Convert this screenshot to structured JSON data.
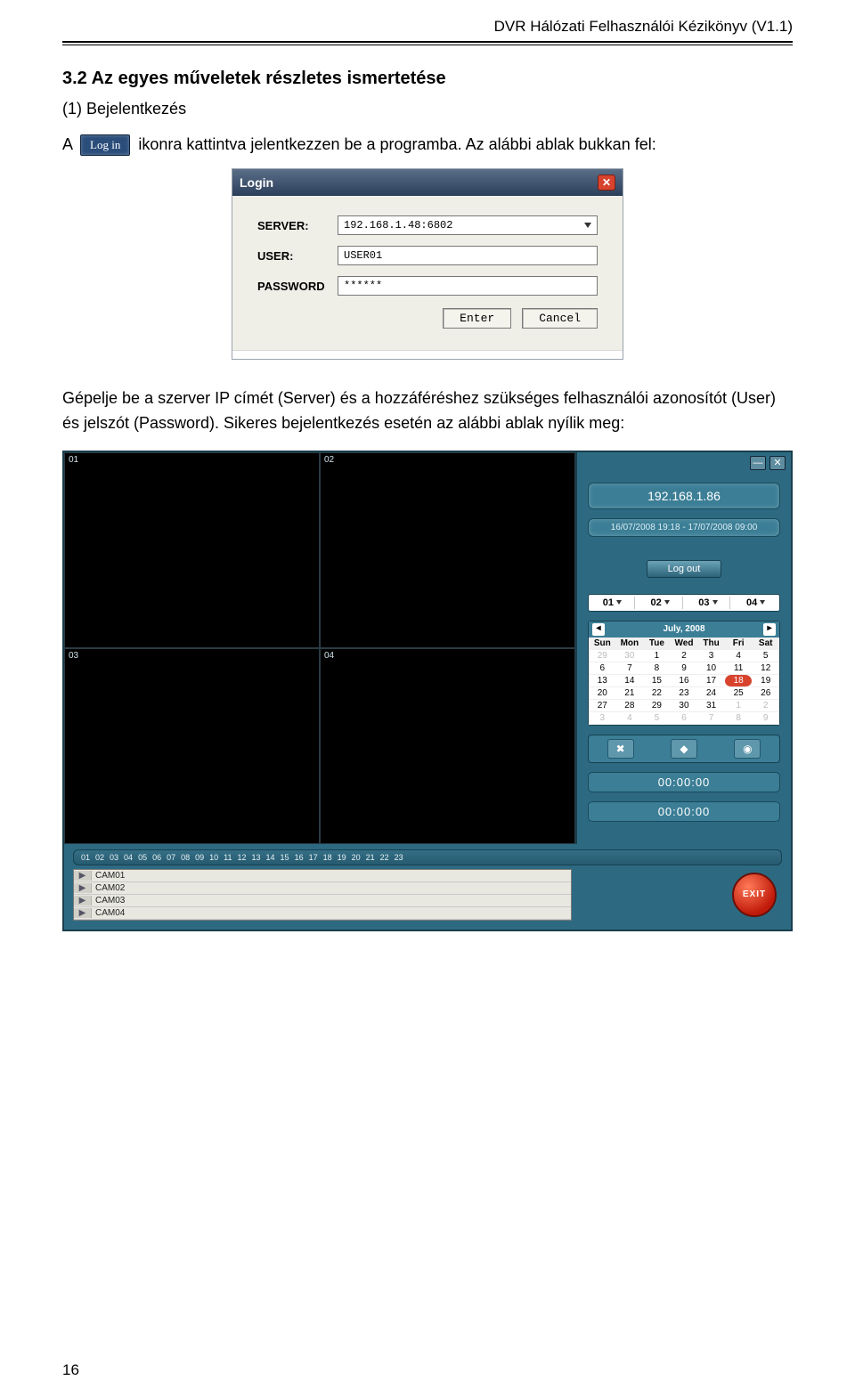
{
  "header": {
    "title": "DVR Hálózati Felhasználói Kézikönyv (V1.1)"
  },
  "page_number": "16",
  "section": {
    "title": "3.2 Az egyes műveletek részletes ismertetése",
    "step_label": "(1) Bejelentkezés",
    "lead_prefix": "A",
    "login_chip": "Log in",
    "lead_suffix": " ikonra kattintva jelentkezzen be a programba. Az alábbi ablak bukkan fel:"
  },
  "login_dialog": {
    "title": "Login",
    "close": "✕",
    "fields": {
      "server_label": "SERVER:",
      "server_value": "192.168.1.48:6802",
      "user_label": "USER:",
      "user_value": "USER01",
      "password_label": "PASSWORD",
      "password_value": "******"
    },
    "buttons": {
      "enter": "Enter",
      "cancel": "Cancel"
    }
  },
  "paragraph2": "Gépelje be a szerver IP címét (Server) és a hozzáféréshez szükséges felhasználói azonosítót (User) és jelszót (Password). Sikeres bejelentkezés esetén az alábbi ablak nyílik meg:",
  "dvr": {
    "cells": {
      "c1": "01",
      "c2": "02",
      "c3": "03",
      "c4": "04"
    },
    "winctrls": {
      "min": "—",
      "close": "✕"
    },
    "ip": "192.168.1.86",
    "date_range": "16/07/2008 19:18 - 17/07/2008 09:00",
    "logout": "Log out",
    "channels": [
      "01",
      "02",
      "03",
      "04"
    ],
    "calendar": {
      "title": "July, 2008",
      "prev": "◂",
      "next": "▸",
      "dow": [
        "Sun",
        "Mon",
        "Tue",
        "Wed",
        "Thu",
        "Fri",
        "Sat"
      ],
      "rows": [
        [
          "29",
          "30",
          "1",
          "2",
          "3",
          "4",
          "5"
        ],
        [
          "6",
          "7",
          "8",
          "9",
          "10",
          "11",
          "12"
        ],
        [
          "13",
          "14",
          "15",
          "16",
          "17",
          "18",
          "19"
        ],
        [
          "20",
          "21",
          "22",
          "23",
          "24",
          "25",
          "26"
        ],
        [
          "27",
          "28",
          "29",
          "30",
          "31",
          "1",
          "2"
        ],
        [
          "3",
          "4",
          "5",
          "6",
          "7",
          "8",
          "9"
        ]
      ],
      "out_first": 2,
      "out_last_start_row": 4,
      "out_last_start_col": 5,
      "selected": "18"
    },
    "icons": {
      "del": "✖",
      "play": "◆",
      "snap": "◉"
    },
    "timer1": "00:00:00",
    "timer2": "00:00:00",
    "timeline": [
      "01",
      "02",
      "03",
      "04",
      "05",
      "06",
      "07",
      "08",
      "09",
      "10",
      "11",
      "12",
      "13",
      "14",
      "15",
      "16",
      "17",
      "18",
      "19",
      "20",
      "21",
      "22",
      "23"
    ],
    "cams": [
      "CAM01",
      "CAM02",
      "CAM03",
      "CAM04"
    ],
    "play_glyph": "▶",
    "exit": "EXIT"
  }
}
